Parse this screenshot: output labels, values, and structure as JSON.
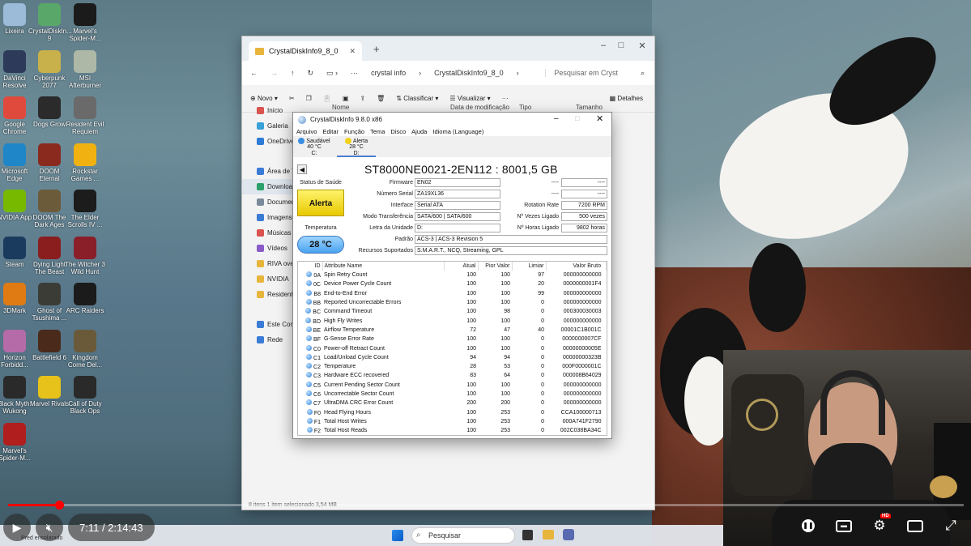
{
  "desktop_icons": [
    {
      "label": "Lixeira",
      "color": "#9bbbd8"
    },
    {
      "label": "CrystalDiskIn... 9",
      "color": "#5aa76a"
    },
    {
      "label": "Marvel's Spider-M...",
      "color": "#1b1b1b"
    },
    {
      "label": "DaVinci Resolve",
      "color": "#2d3a59"
    },
    {
      "label": "Cyberpunk 2077",
      "color": "#c8b04a"
    },
    {
      "label": "MSI Afterburner",
      "color": "#aeb8a6"
    },
    {
      "label": "Google Chrome",
      "color": "#e04a3c"
    },
    {
      "label": "Dogs Grow",
      "color": "#2b2b2b"
    },
    {
      "label": "Resident Evil Requiem",
      "color": "#6a6a6a"
    },
    {
      "label": "Microsoft Edge",
      "color": "#1f86c8"
    },
    {
      "label": "DOOM Eternal",
      "color": "#8a2a1f"
    },
    {
      "label": "Rockstar Games ...",
      "color": "#f1b211"
    },
    {
      "label": "NVIDIA App",
      "color": "#76b900"
    },
    {
      "label": "DOOM The Dark Ages",
      "color": "#6b5b3a"
    },
    {
      "label": "The Elder Scrolls IV ...",
      "color": "#1c1c1c"
    },
    {
      "label": "Steam",
      "color": "#1b3b5e"
    },
    {
      "label": "Dying Light The Beast",
      "color": "#8a1e1e"
    },
    {
      "label": "The Witcher 3 Wild Hunt",
      "color": "#8a1f2a"
    },
    {
      "label": "3DMark",
      "color": "#e07b14"
    },
    {
      "label": "Ghost of Tsushima ...",
      "color": "#3c3c36"
    },
    {
      "label": "ARC Raiders",
      "color": "#1b1b1b"
    },
    {
      "label": "Horizon Forbidd...",
      "color": "#b46ba8"
    },
    {
      "label": "Battlefield 6",
      "color": "#4a2a1a"
    },
    {
      "label": "Kingdom Come Del...",
      "color": "#6a5a3a"
    },
    {
      "label": "Black Myth: Wukong",
      "color": "#2a2a2a"
    },
    {
      "label": "Marvel Rivals",
      "color": "#e6c21a"
    },
    {
      "label": "Call of Duty Black Ops",
      "color": "#2a2a2a"
    },
    {
      "label": "Marvel's Spider-M...",
      "color": "#b01e1e"
    }
  ],
  "explorer": {
    "tab_title": "CrystalDiskInfo9_8_0",
    "new_tab": "+",
    "breadcrumb": [
      "crystal info",
      "CrystalDiskInfo9_8_0"
    ],
    "search_placeholder": "Pesquisar em Cryst",
    "cmd": {
      "new": "Novo",
      "sort": "Classificar",
      "view": "Visualizar",
      "more": "···",
      "details": "Detalhes"
    },
    "columns": {
      "name": "Nome",
      "modified": "Data de modificação",
      "type": "Tipo",
      "size": "Tamanho"
    },
    "sidebar": [
      {
        "label": "Início",
        "color": "#d9534f"
      },
      {
        "label": "Galeria",
        "color": "#3aa0d8"
      },
      {
        "label": "OneDrive",
        "color": "#2c7bd6"
      },
      {
        "label": "Área de Tr",
        "color": "#3a7bd5"
      },
      {
        "label": "Downloads",
        "color": "#2aa06a"
      },
      {
        "label": "Documen",
        "color": "#7a8a9a"
      },
      {
        "label": "Imagens",
        "color": "#3a7bd5"
      },
      {
        "label": "Músicas",
        "color": "#d9534f"
      },
      {
        "label": "Vídeos",
        "color": "#8a5ac8"
      },
      {
        "label": "RIVA over",
        "color": "#e8b53c"
      },
      {
        "label": "NVIDIA",
        "color": "#e8b53c"
      },
      {
        "label": "Resident E",
        "color": "#e8b53c"
      },
      {
        "label": "Este Comp",
        "color": "#3a7bd5"
      },
      {
        "label": "Rede",
        "color": "#3a7bd5"
      }
    ],
    "status": "8 itens   1 item selecionado 3,54 MB"
  },
  "cdi": {
    "title": "CrystalDiskInfo 9.8.0 x86",
    "menu": [
      "Arquivo",
      "Editar",
      "Função",
      "Tema",
      "Disco",
      "Ajuda",
      "Idioma (Language)"
    ],
    "drives": [
      {
        "status": "Saudável",
        "temp": "40 °C",
        "letter": "C:",
        "color": "#3a8ee0"
      },
      {
        "status": "Alerta",
        "temp": "28 °C",
        "letter": "D:",
        "color": "#f2d21a"
      }
    ],
    "model": "ST8000NE0021-2EN112 : 8001,5 GB",
    "health_label": "Status de Saúde",
    "health": "Alerta",
    "temp_label": "Temperatura",
    "temp": "28 °C",
    "fields": {
      "firmware_label": "Firmware",
      "firmware": "EN02",
      "serial_label": "Número Serial",
      "serial": "ZA19XL36",
      "interface_label": "Interface",
      "interface": "Serial ATA",
      "transfer_label": "Modo Transferência",
      "transfer": "SATA/600 | SATA/600",
      "letter_label": "Letra da Unidade",
      "letter": "D:",
      "standard_label": "Padrão",
      "standard": "ACS-3 | ACS-3 Revision 5",
      "features_label": "Recursos Suportados",
      "features": "S.M.A.R.T., NCQ, Streaming, GPL",
      "dash1": "----",
      "dash1v": "----",
      "dash2": "----",
      "dash2v": "----",
      "rotation_label": "Rotation Rate",
      "rotation": "7200 RPM",
      "power_count_label": "Nº Vezes Ligado",
      "power_count": "500 vezes",
      "power_hours_label": "Nº Horas Ligado",
      "power_hours": "9802 horas"
    },
    "smart_headers": [
      "ID",
      "Attribute Name",
      "Atual",
      "Pior Valor",
      "Limiar",
      "Valor Bruto"
    ],
    "smart_rows": [
      [
        "0A",
        "Spin Retry Count",
        "100",
        "100",
        "97",
        "000000000000"
      ],
      [
        "0C",
        "Device Power Cycle Count",
        "100",
        "100",
        "20",
        "0000000001F4"
      ],
      [
        "B8",
        "End-to-End Error",
        "100",
        "100",
        "99",
        "000000000000"
      ],
      [
        "BB",
        "Reported Uncorrectable Errors",
        "100",
        "100",
        "0",
        "000000000000"
      ],
      [
        "BC",
        "Command Timeout",
        "100",
        "98",
        "0",
        "000300030003"
      ],
      [
        "BD",
        "High Fly Writes",
        "100",
        "100",
        "0",
        "000000000000"
      ],
      [
        "BE",
        "Airflow Temperature",
        "72",
        "47",
        "40",
        "00001C1B001C"
      ],
      [
        "BF",
        "G-Sense Error Rate",
        "100",
        "100",
        "0",
        "0000000007CF"
      ],
      [
        "C0",
        "Power-off Retract Count",
        "100",
        "100",
        "0",
        "00000000005E"
      ],
      [
        "C1",
        "Load/Unload Cycle Count",
        "94",
        "94",
        "0",
        "00000000323B"
      ],
      [
        "C2",
        "Temperature",
        "28",
        "53",
        "0",
        "000F0000001C"
      ],
      [
        "C3",
        "Hardware ECC recovered",
        "83",
        "64",
        "0",
        "000008B64029"
      ],
      [
        "C5",
        "Current Pending Sector Count",
        "100",
        "100",
        "0",
        "000000000000"
      ],
      [
        "C6",
        "Uncorrectable Sector Count",
        "100",
        "100",
        "0",
        "000000000000"
      ],
      [
        "C7",
        "UltraDMA CRC Error Count",
        "200",
        "200",
        "0",
        "000000000000"
      ],
      [
        "F0",
        "Head Flying Hours",
        "100",
        "253",
        "0",
        "CCA100000713"
      ],
      [
        "F1",
        "Total Host Writes",
        "100",
        "253",
        "0",
        "000A741F2790"
      ],
      [
        "F2",
        "Total Host Reads",
        "100",
        "253",
        "0",
        "002C038BA34C"
      ]
    ]
  },
  "taskbar": {
    "search": "Pesquisar",
    "weather": "Pred ensolarado"
  },
  "player": {
    "time": "7:11 / 2:14:43",
    "progress_fraction": 0.053,
    "hd_badge": "HD"
  }
}
